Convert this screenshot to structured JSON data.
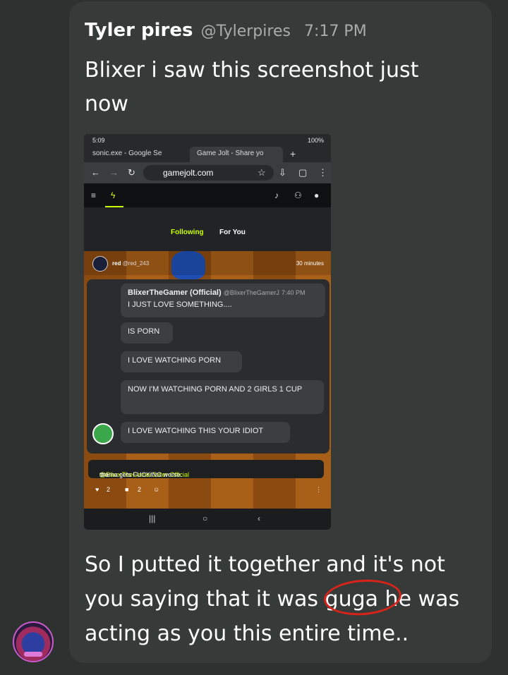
{
  "post": {
    "author": "Tyler pires",
    "handle": "@Tylerpires",
    "time": "7:17 PM",
    "message_top": "Blixer i saw this screenshot just now",
    "message_bottom": "So I putted it together and it's not you saying that it was guga he was acting as you this entire time..",
    "highlight_word": "guga",
    "highlight_color": "#d8231b"
  },
  "screenshot": {
    "status_time": "5:09",
    "status_right": "100%",
    "tab1": "sonic.exe - Google Se",
    "tab2": "Game Jolt - Share yo",
    "url": "gamejolt.com",
    "feed_tabs": [
      "Following",
      "For You"
    ],
    "post_user": "red",
    "post_handle": "@red_243",
    "post_time": "30 minutes",
    "chat": {
      "name": "BlixerTheGamer (Official)",
      "handle": "@BlixerTheGamerJ",
      "time": "7:40 PM",
      "messages": [
        "I JUST LOVE SOMETHING....",
        "IS PORN",
        "I LOVE WATCHING PORN",
        "NOW I'M WATCHING PORN AND 2 GIRLS 1 CUP",
        "I LOVE WATCHING THIS YOUR IDIOT"
      ]
    },
    "caption_prefix": "the",
    "caption_mention": "@BlixerTheGamerJolter-Official",
    "caption_suffix": "drama gets FUCKING worse.",
    "likes": "2",
    "comments": "2"
  },
  "icons": {
    "back": "arrow-left-icon",
    "forward": "arrow-right-icon",
    "reload": "reload-icon",
    "star": "star-icon",
    "download": "download-icon",
    "tabs": "tabs-icon",
    "menu": "more-vert-icon"
  }
}
